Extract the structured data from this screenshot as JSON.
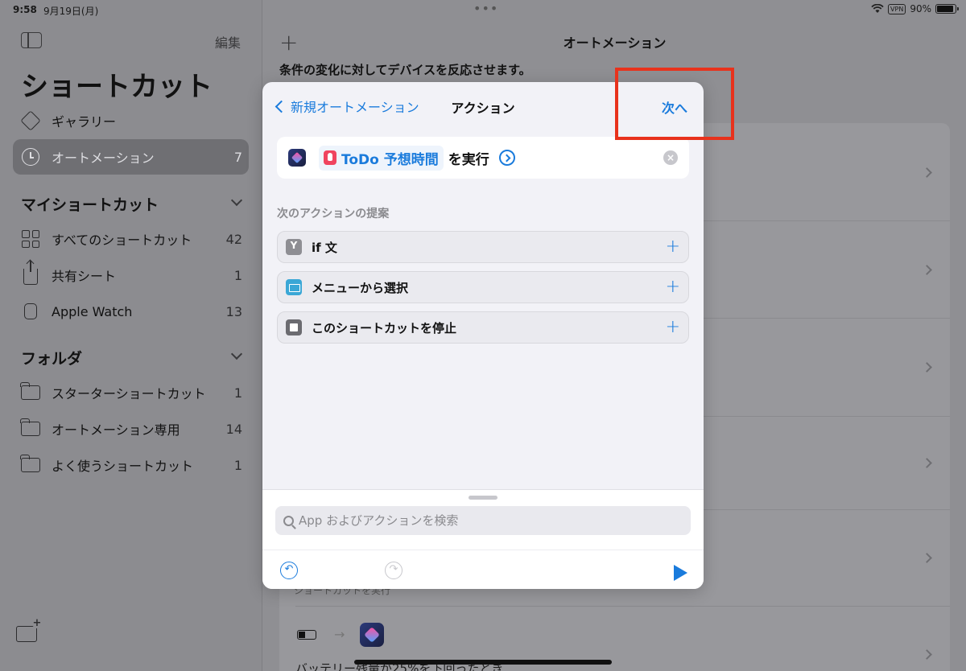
{
  "status_bar": {
    "time": "9:58",
    "date": "9月19日(月)",
    "dots": "•••",
    "vpn": "VPN",
    "battery": "90%"
  },
  "sidebar": {
    "edit_label": "編集",
    "title": "ショートカット",
    "top_items": [
      {
        "label": "ギャラリー",
        "count": "",
        "icon": "gallery-icon"
      },
      {
        "label": "オートメーション",
        "count": "7",
        "icon": "automation-clock-icon"
      }
    ],
    "my_shortcuts_header": "マイショートカット",
    "my_shortcuts": [
      {
        "label": "すべてのショートカット",
        "count": "42",
        "icon": "grid-icon"
      },
      {
        "label": "共有シート",
        "count": "1",
        "icon": "share-icon"
      },
      {
        "label": "Apple Watch",
        "count": "13",
        "icon": "watch-icon"
      }
    ],
    "folders_header": "フォルダ",
    "folders": [
      {
        "label": "スターターショートカット",
        "count": "1",
        "icon": "folder-icon"
      },
      {
        "label": "オートメーション専用",
        "count": "14",
        "icon": "folder-icon"
      },
      {
        "label": "よく使うショートカット",
        "count": "1",
        "icon": "folder-icon"
      }
    ]
  },
  "main": {
    "add_label": "+",
    "title": "オートメーション",
    "subtitle": "条件の変化に対してデバイスを反応させます。",
    "bg_partial_label": "ショートカットを実行",
    "bg_last_item": "バッテリー残量が25%を下回ったとき",
    "arrow": "→"
  },
  "modal": {
    "back_label": "新規オートメーション",
    "title": "アクション",
    "next_label": "次へ",
    "action": {
      "shortcut_name": "ToDo 予想時間",
      "run_label": "を実行",
      "clear_label": "×"
    },
    "suggestions_header": "次のアクションの提案",
    "suggestions": [
      {
        "label": "if 文",
        "icon": "if-icon",
        "plus": "+"
      },
      {
        "label": "メニューから選択",
        "icon": "menu-icon",
        "plus": "+"
      },
      {
        "label": "このショートカットを停止",
        "icon": "stop-icon",
        "plus": "+"
      }
    ],
    "search_placeholder": "App およびアクションを検索",
    "undo_label": "↶",
    "redo_label": "↷"
  },
  "colors": {
    "accent": "#1a7bdc",
    "highlight": "#e8321c"
  }
}
